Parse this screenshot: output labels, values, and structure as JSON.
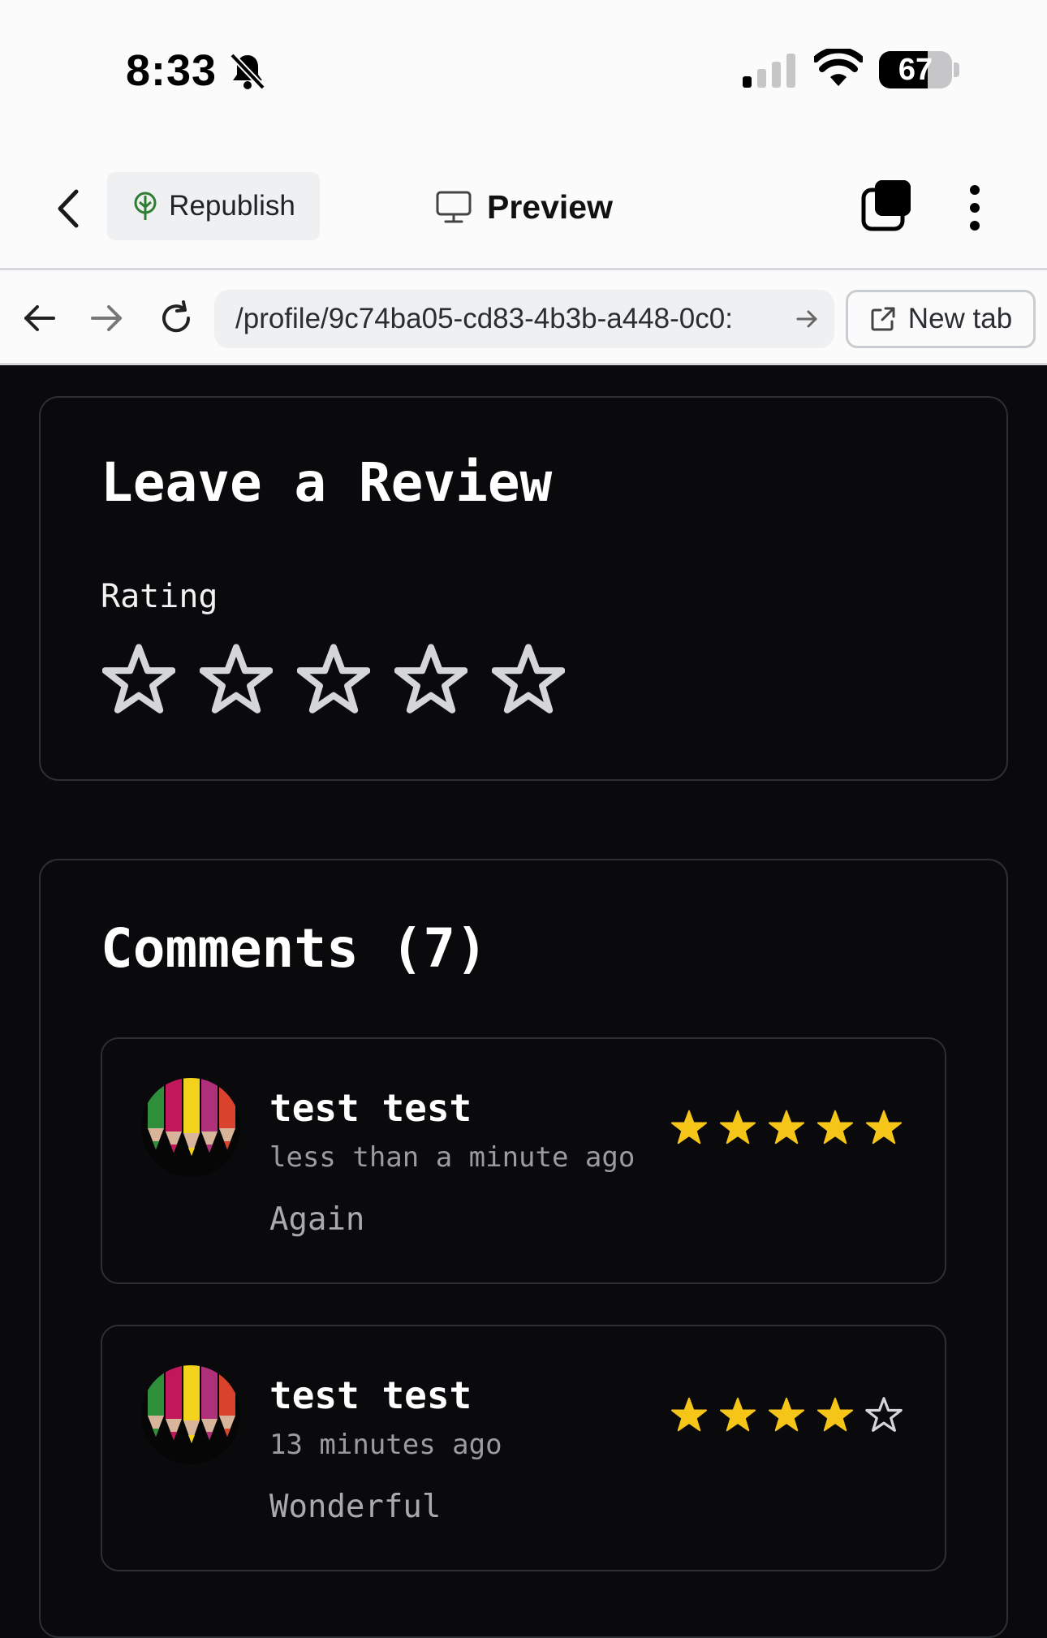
{
  "status_bar": {
    "time": "8:33",
    "battery": "67"
  },
  "toolbar": {
    "republish_label": "Republish",
    "preview_label": "Preview"
  },
  "browser": {
    "url": "/profile/9c74ba05-cd83-4b3b-a448-0c0:",
    "new_tab_label": "New tab"
  },
  "review_form": {
    "title": "Leave a Review",
    "rating_label": "Rating",
    "rating_value": 0,
    "max_rating": 5
  },
  "comments": {
    "title": "Comments (7)",
    "items": [
      {
        "author": "test test",
        "time": "less than a minute ago",
        "body": "Again",
        "rating": 5
      },
      {
        "author": "test test",
        "time": "13 minutes ago",
        "body": "Wonderful",
        "rating": 4
      }
    ]
  },
  "colors": {
    "page_background": "#0a0a0c",
    "star_filled": "#f5c518",
    "star_empty": "#d4d6da",
    "brand_green": "#2e7d32"
  }
}
